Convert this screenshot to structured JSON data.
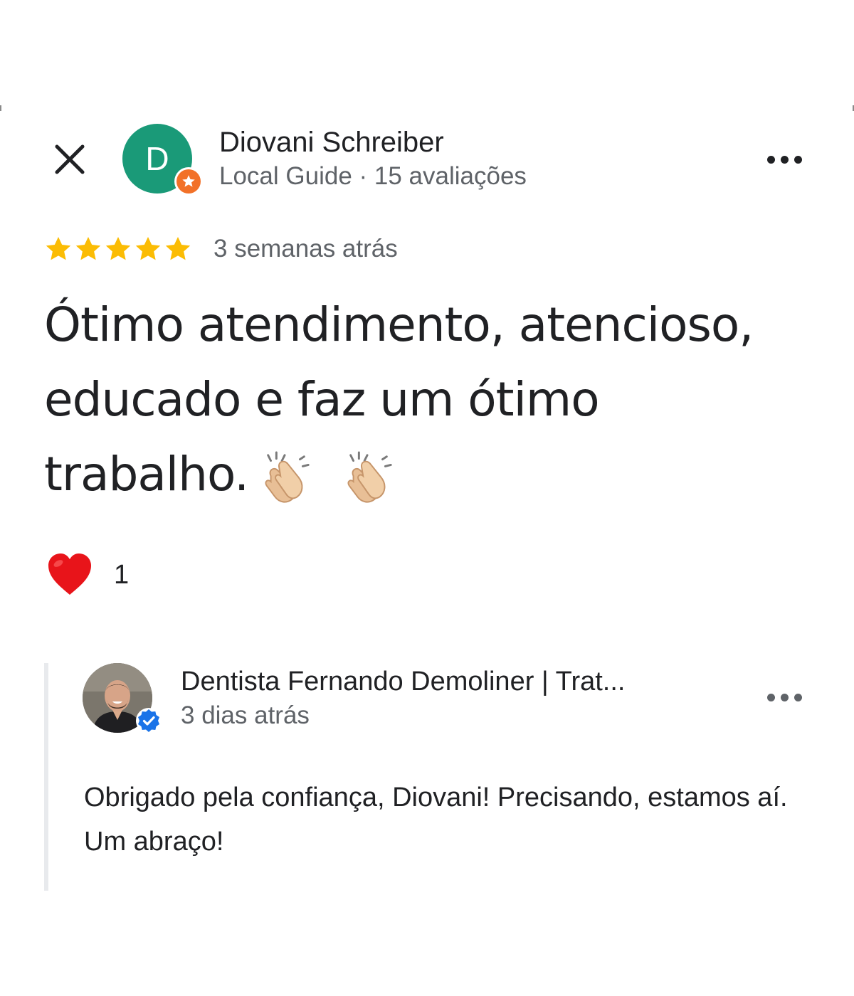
{
  "reviewer": {
    "avatar_letter": "D",
    "avatar_color": "#1a9a78",
    "badge_color": "#f27128",
    "name": "Diovani Schreiber",
    "meta": "Local Guide · 15 avaliações"
  },
  "review": {
    "rating": 5,
    "star_color": "#fbbc04",
    "time": "3 semanas atrás",
    "text_line1": "Ótimo atendimento, atencioso,",
    "text_line2": "educado e faz um ótimo",
    "text_line3": "trabalho.",
    "emojis": [
      "clapping-hands",
      "clapping-hands"
    ]
  },
  "reactions": {
    "icon": "heart-icon",
    "count": "1"
  },
  "owner_reply": {
    "name": "Dentista Fernando Demoliner | Trat...",
    "time": "3 dias atrás",
    "text": "Obrigado pela confiança, Diovani! Precisando, estamos aí. Um abraço!",
    "verified_color": "#1a73e8"
  },
  "icons": {
    "close": "close-icon",
    "more": "more-horizontal-icon",
    "badge": "local-guide-star-icon",
    "verified": "verified-check-icon"
  }
}
